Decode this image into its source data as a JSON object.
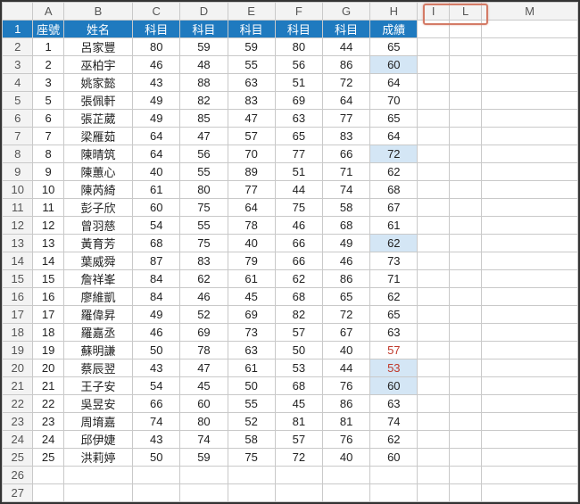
{
  "columns": [
    "A",
    "B",
    "C",
    "D",
    "E",
    "F",
    "G",
    "H",
    "I",
    "L",
    "M"
  ],
  "row_numbers": [
    "1",
    "2",
    "3",
    "4",
    "5",
    "6",
    "7",
    "8",
    "9",
    "10",
    "11",
    "12",
    "13",
    "14",
    "15",
    "16",
    "17",
    "18",
    "19",
    "20",
    "21",
    "22",
    "23",
    "24",
    "25",
    "26",
    "27"
  ],
  "header": {
    "A": "座號",
    "B": "姓名",
    "C": "科目",
    "D": "科目",
    "E": "科目",
    "F": "科目",
    "G": "科目",
    "H": "成績"
  },
  "rows": [
    {
      "A": "1",
      "B": "呂家豐",
      "C": "80",
      "D": "59",
      "E": "59",
      "F": "80",
      "G": "44",
      "H": "65"
    },
    {
      "A": "2",
      "B": "巫柏宇",
      "C": "46",
      "D": "48",
      "E": "55",
      "F": "56",
      "G": "86",
      "H": "60",
      "hlH": true
    },
    {
      "A": "3",
      "B": "姚家懿",
      "C": "43",
      "D": "88",
      "E": "63",
      "F": "51",
      "G": "72",
      "H": "64"
    },
    {
      "A": "5",
      "B": "張佩軒",
      "C": "49",
      "D": "82",
      "E": "83",
      "F": "69",
      "G": "64",
      "H": "70"
    },
    {
      "A": "6",
      "B": "張芷葳",
      "C": "49",
      "D": "85",
      "E": "47",
      "F": "63",
      "G": "77",
      "H": "65"
    },
    {
      "A": "7",
      "B": "梁雁茹",
      "C": "64",
      "D": "47",
      "E": "57",
      "F": "65",
      "G": "83",
      "H": "64"
    },
    {
      "A": "8",
      "B": "陳晴筑",
      "C": "64",
      "D": "56",
      "E": "70",
      "F": "77",
      "G": "66",
      "H": "72",
      "hlH": true
    },
    {
      "A": "9",
      "B": "陳蕙心",
      "C": "40",
      "D": "55",
      "E": "89",
      "F": "51",
      "G": "71",
      "H": "62"
    },
    {
      "A": "10",
      "B": "陳芮綺",
      "C": "61",
      "D": "80",
      "E": "77",
      "F": "44",
      "G": "74",
      "H": "68"
    },
    {
      "A": "11",
      "B": "彭子欣",
      "C": "60",
      "D": "75",
      "E": "64",
      "F": "75",
      "G": "58",
      "H": "67"
    },
    {
      "A": "12",
      "B": "曾羽慈",
      "C": "54",
      "D": "55",
      "E": "78",
      "F": "46",
      "G": "68",
      "H": "61"
    },
    {
      "A": "13",
      "B": "黃育芳",
      "C": "68",
      "D": "75",
      "E": "40",
      "F": "66",
      "G": "49",
      "H": "62",
      "hlH": true
    },
    {
      "A": "14",
      "B": "葉威舜",
      "C": "87",
      "D": "83",
      "E": "79",
      "F": "66",
      "G": "46",
      "H": "73"
    },
    {
      "A": "15",
      "B": "詹祥峯",
      "C": "84",
      "D": "62",
      "E": "61",
      "F": "62",
      "G": "86",
      "H": "71"
    },
    {
      "A": "16",
      "B": "廖維凱",
      "C": "84",
      "D": "46",
      "E": "45",
      "F": "68",
      "G": "65",
      "H": "62"
    },
    {
      "A": "17",
      "B": "羅偉昇",
      "C": "49",
      "D": "52",
      "E": "69",
      "F": "82",
      "G": "72",
      "H": "65"
    },
    {
      "A": "18",
      "B": "羅嘉丞",
      "C": "46",
      "D": "69",
      "E": "73",
      "F": "57",
      "G": "67",
      "H": "63"
    },
    {
      "A": "19",
      "B": "蘇明謙",
      "C": "50",
      "D": "78",
      "E": "63",
      "F": "50",
      "G": "40",
      "H": "57",
      "redH": true
    },
    {
      "A": "20",
      "B": "蔡辰翌",
      "C": "43",
      "D": "47",
      "E": "61",
      "F": "53",
      "G": "44",
      "H": "53",
      "hlH": true,
      "redH": true
    },
    {
      "A": "21",
      "B": "王子安",
      "C": "54",
      "D": "45",
      "E": "50",
      "F": "68",
      "G": "76",
      "H": "60",
      "hlH": true
    },
    {
      "A": "22",
      "B": "吳昱安",
      "C": "66",
      "D": "60",
      "E": "55",
      "F": "45",
      "G": "86",
      "H": "63"
    },
    {
      "A": "23",
      "B": "周堉嘉",
      "C": "74",
      "D": "80",
      "E": "52",
      "F": "81",
      "G": "81",
      "H": "74"
    },
    {
      "A": "24",
      "B": "邱伊婕",
      "C": "43",
      "D": "74",
      "E": "58",
      "F": "57",
      "G": "76",
      "H": "62"
    },
    {
      "A": "25",
      "B": "洪莉婷",
      "C": "50",
      "D": "59",
      "E": "75",
      "F": "72",
      "G": "40",
      "H": "60"
    }
  ],
  "chart_data": {
    "type": "table",
    "title": "成績表",
    "columns": [
      "座號",
      "姓名",
      "科目",
      "科目",
      "科目",
      "科目",
      "科目",
      "成績"
    ],
    "data": [
      [
        1,
        "呂家豐",
        80,
        59,
        59,
        80,
        44,
        65
      ],
      [
        2,
        "巫柏宇",
        46,
        48,
        55,
        56,
        86,
        60
      ],
      [
        3,
        "姚家懿",
        43,
        88,
        63,
        51,
        72,
        64
      ],
      [
        5,
        "張佩軒",
        49,
        82,
        83,
        69,
        64,
        70
      ],
      [
        6,
        "張芷葳",
        49,
        85,
        47,
        63,
        77,
        65
      ],
      [
        7,
        "梁雁茹",
        64,
        47,
        57,
        65,
        83,
        64
      ],
      [
        8,
        "陳晴筑",
        64,
        56,
        70,
        77,
        66,
        72
      ],
      [
        9,
        "陳蕙心",
        40,
        55,
        89,
        51,
        71,
        62
      ],
      [
        10,
        "陳芮綺",
        61,
        80,
        77,
        44,
        74,
        68
      ],
      [
        11,
        "彭子欣",
        60,
        75,
        64,
        75,
        58,
        67
      ],
      [
        12,
        "曾羽慈",
        54,
        55,
        78,
        46,
        68,
        61
      ],
      [
        13,
        "黃育芳",
        68,
        75,
        40,
        66,
        49,
        62
      ],
      [
        14,
        "葉威舜",
        87,
        83,
        79,
        66,
        46,
        73
      ],
      [
        15,
        "詹祥峯",
        84,
        62,
        61,
        62,
        86,
        71
      ],
      [
        16,
        "廖維凱",
        84,
        46,
        45,
        68,
        65,
        62
      ],
      [
        17,
        "羅偉昇",
        49,
        52,
        69,
        82,
        72,
        65
      ],
      [
        18,
        "羅嘉丞",
        46,
        69,
        73,
        57,
        67,
        63
      ],
      [
        19,
        "蘇明謙",
        50,
        78,
        63,
        50,
        40,
        57
      ],
      [
        20,
        "蔡辰翌",
        43,
        47,
        61,
        53,
        44,
        53
      ],
      [
        21,
        "王子安",
        54,
        45,
        50,
        68,
        76,
        60
      ],
      [
        22,
        "吳昱安",
        66,
        60,
        55,
        45,
        86,
        63
      ],
      [
        23,
        "周堉嘉",
        74,
        80,
        52,
        81,
        81,
        74
      ],
      [
        24,
        "邱伊婕",
        43,
        74,
        58,
        57,
        76,
        62
      ],
      [
        25,
        "洪莉婷",
        50,
        59,
        75,
        72,
        40,
        60
      ]
    ]
  }
}
